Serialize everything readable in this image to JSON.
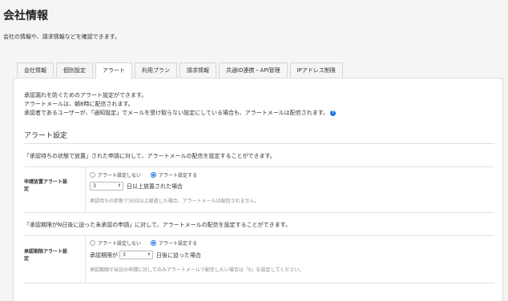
{
  "header": {
    "title": "会社情報",
    "subtitle": "会社の情報や、請求情報などを確認できます。"
  },
  "tabs": [
    {
      "label": "会社情報",
      "active": false
    },
    {
      "label": "個別設定",
      "active": false
    },
    {
      "label": "アラート",
      "active": true
    },
    {
      "label": "利用プラン",
      "active": false
    },
    {
      "label": "請求情報",
      "active": false
    },
    {
      "label": "共通ID連携・API管理",
      "active": false
    },
    {
      "label": "IPアドレス制限",
      "active": false
    }
  ],
  "intro": {
    "line1": "承認漏れを防ぐためのアラート設定ができます。",
    "line2": "アラートメールは、朝8時に配信されます。",
    "line3": "承認者であるユーザーが、「通知設定」でメールを受け取らない設定にしている場合も、アラートメールは配信されます。",
    "help_icon": "question-circle-icon"
  },
  "section": {
    "title": "アラート設定"
  },
  "rule1": {
    "title": "「承認待ちの状態で放置」された申請に対して、アラートメールの配信を設定することができます。",
    "label_line1": "申請放置アラート設",
    "label_line2": "定",
    "option_off": "アラート設定しない",
    "option_on": "アラート設定する",
    "selected": "on",
    "value": "3",
    "suffix": "日以上放置された場合",
    "note": "承認待ちの状態で30日以上経過した場合、アラートメールは配信されません。"
  },
  "rule2": {
    "title": "「承認期限がN日後に迫った未承認の申請」に対して、アラートメールの配信を設定することができます。",
    "label_line1": "承認期限アラート設",
    "label_line2": "定",
    "option_off": "アラート設定しない",
    "option_on": "アラート設定する",
    "selected": "on",
    "prefix": "承認期限が",
    "value": "3",
    "suffix": "日後に迫った場合",
    "note": "承認期限が当日の申請に対してのみアラートメールで配信したい場合は「0」を設定してください。"
  },
  "colors": {
    "accent": "#1a73e8",
    "background": "#f5f5f5",
    "panel": "#ffffff"
  }
}
